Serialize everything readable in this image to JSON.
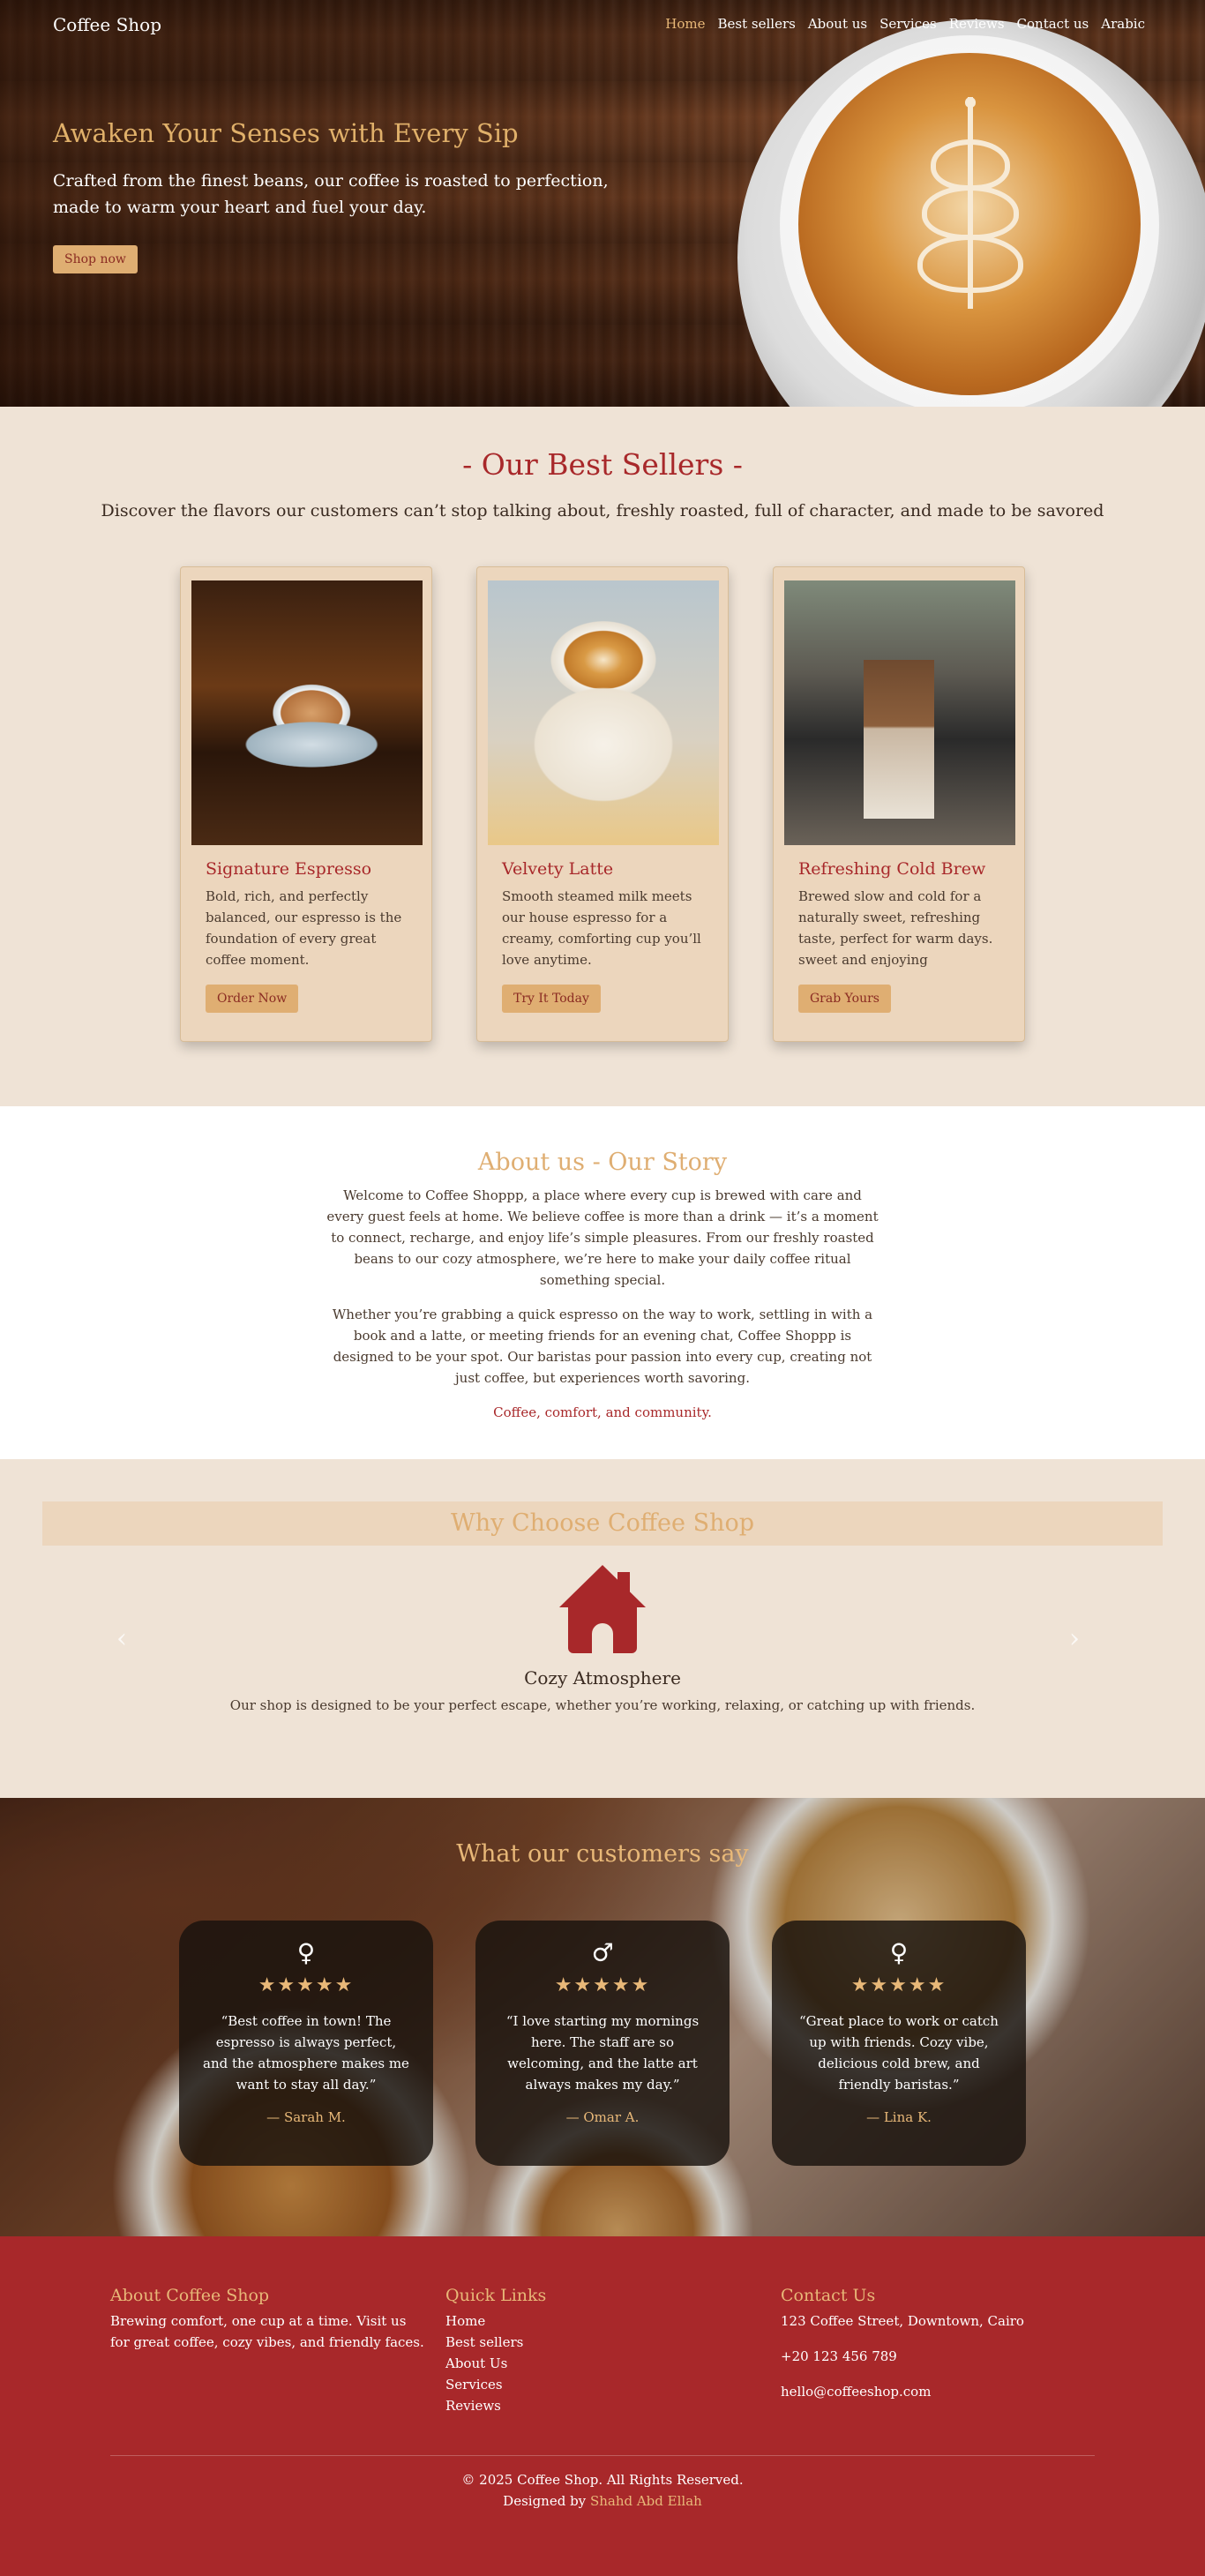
{
  "nav": {
    "brand": "Coffee Shop",
    "links": [
      "Home",
      "Best sellers",
      "About us",
      "Services",
      "Reviews",
      "Contact us",
      "Arabic"
    ],
    "active_link": "Home"
  },
  "hero": {
    "title": "Awaken Your Senses with Every Sip",
    "subtitle_line1": "Crafted from the finest beans, our coffee is roasted to perfection,",
    "subtitle_line2": "made to warm your heart and fuel your day.",
    "cta": "Shop now"
  },
  "best": {
    "title": "- Our Best Sellers -",
    "lead": "Discover the flavors our customers can’t stop talking about, freshly roasted, full of character, and made to be savored",
    "cards": [
      {
        "name": "Signature Espresso",
        "desc": "Bold, rich, and perfectly balanced, our espresso is the foundation of every great coffee moment.",
        "cta": "Order Now"
      },
      {
        "name": "Velvety Latte",
        "desc": "Smooth steamed milk meets our house espresso for a creamy, comforting cup you’ll love anytime.",
        "cta": "Try It Today"
      },
      {
        "name": "Refreshing Cold Brew",
        "desc": "Brewed slow and cold for a naturally sweet, refreshing taste, perfect for warm days. sweet and enjoying",
        "cta": "Grab Yours"
      }
    ]
  },
  "about": {
    "title": "About us - Our Story",
    "p1": "Welcome to Coffee Shoppp, a place where every cup is brewed with care and every guest feels at home. We believe coffee is more than a drink — it’s a moment to connect, recharge, and enjoy life’s simple pleasures. From our freshly roasted beans to our cozy atmosphere, we’re here to make your daily coffee ritual something special.",
    "p2": "Whether you’re grabbing a quick espresso on the way to work, settling in with a book and a latte, or meeting friends for an evening chat, Coffee Shoppp is designed to be your spot. Our baristas pour passion into every cup, creating not just coffee, but experiences worth savoring.",
    "tagline": "Coffee, comfort, and community."
  },
  "why": {
    "title": "Why Choose Coffee Shop",
    "item_icon": "house-icon",
    "item_title": "Cozy Atmosphere",
    "item_desc": "Our shop is designed to be your perfect escape, whether you’re working, relaxing, or catching up with friends.",
    "prev": "‹",
    "next": "›"
  },
  "reviews": {
    "title": "What our customers say",
    "items": [
      {
        "gender": "♀",
        "gender_icon": "female-icon",
        "stars": "★★★★★",
        "rating": 5,
        "quote": "“Best coffee in town! The espresso is always perfect, and the atmosphere makes me want to stay all day.”",
        "author": "— Sarah M."
      },
      {
        "gender": "♂",
        "gender_icon": "male-icon",
        "stars": "★★★★★",
        "rating": 5,
        "quote": "“I love starting my mornings here. The staff are so welcoming, and the latte art always makes my day.”",
        "author": "— Omar A."
      },
      {
        "gender": "♀",
        "gender_icon": "female-icon",
        "stars": "★★★★★",
        "rating": 5,
        "quote": "“Great place to work or catch up with friends. Cozy vibe, delicious cold brew, and friendly baristas.”",
        "author": "— Lina K."
      }
    ]
  },
  "footer": {
    "about_title": "About Coffee Shop",
    "about_text": "Brewing comfort, one cup at a time. Visit us for great coffee, cozy vibes, and friendly faces.",
    "links_title": "Quick Links",
    "links": [
      "Home",
      "Best sellers",
      "About Us",
      "Services",
      "Reviews"
    ],
    "contact_title": "Contact Us",
    "address": "123 Coffee Street, Downtown, Cairo",
    "phone": "+20 123 456 789",
    "email": "hello@coffeeshop.com",
    "copyright": "© 2025 Coffee Shop. All Rights Reserved.",
    "designed_by": "Designed by",
    "author": "Shahd Abd Ellah"
  },
  "colors": {
    "brand_red": "#a8282a",
    "accent_tan": "#dfae72",
    "cream": "#efe3d6"
  }
}
